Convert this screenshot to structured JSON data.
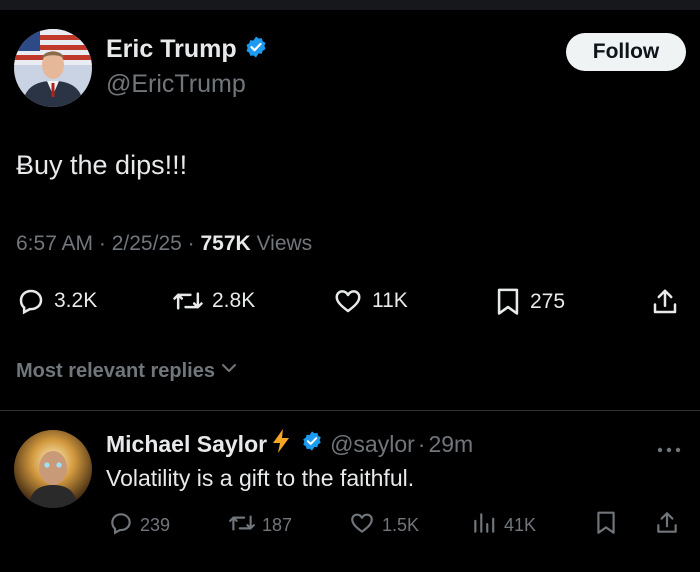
{
  "tweet": {
    "author_name": "Eric Trump",
    "author_handle": "@EricTrump",
    "follow_label": "Follow",
    "text": "Ƀuy the dips!!!",
    "time": "6:57 AM",
    "date": "2/25/25",
    "views_count": "757K",
    "views_label": "Views",
    "replies": "3.2K",
    "reposts": "2.8K",
    "likes": "11K",
    "bookmarks": "275"
  },
  "replies_sort": {
    "label": "Most relevant replies"
  },
  "reply": {
    "author_name": "Michael Saylor",
    "author_handle": "@saylor",
    "time": "29m",
    "text": "Volatility is a gift to the faithful.",
    "replies": "239",
    "reposts": "187",
    "likes": "1.5K",
    "views": "41K"
  },
  "icons": {
    "verified": "verified-badge-icon",
    "lightning": "lightning-emoji-icon"
  },
  "colors": {
    "background": "#000000",
    "verified_blue": "#1d9bf0",
    "muted": "#71767b",
    "text": "#e7e9ea",
    "follow_bg": "#eff3f4"
  }
}
